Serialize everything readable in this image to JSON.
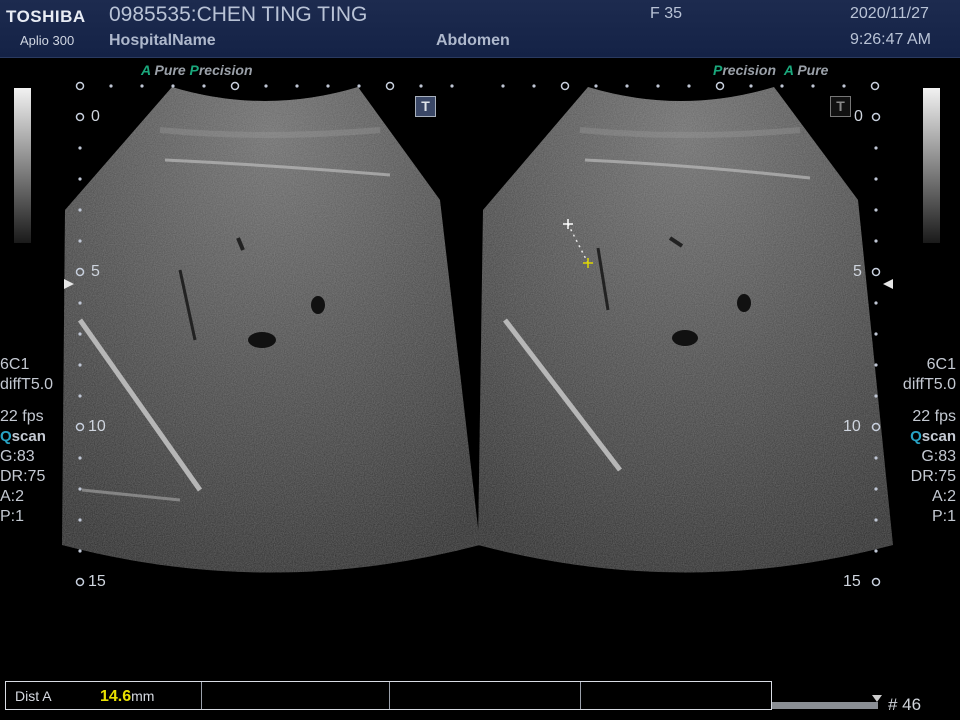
{
  "header": {
    "brand": "TOSHIBA",
    "model": "Aplio 300",
    "patient": "0985535:CHEN TING TING",
    "hospital": "HospitalName",
    "frame_rate_label": "F  35",
    "exam": "Abdomen",
    "date": "2020/11/27",
    "time": "9:26:47 AM"
  },
  "left_panel": {
    "tag_a": "A",
    "tag_pure": "Pure",
    "tag_p": "P",
    "tag_precision": "recision",
    "t_icon": "T",
    "depth_marks": [
      "0",
      "5",
      "10",
      "15"
    ]
  },
  "right_panel": {
    "tag_p": "P",
    "tag_precision": "recision",
    "tag_a": "A",
    "tag_pure": "Pure",
    "t_icon": "T",
    "depth_marks": [
      "0",
      "5",
      "10",
      "15"
    ]
  },
  "settings_left": {
    "probe": "6C1",
    "mode": "diffT5.0",
    "fps": "22 fps",
    "scan_q": "Q",
    "scan_rest": "scan",
    "gain": "G:83",
    "dr": "DR:75",
    "a": "A:2",
    "p": "P:1"
  },
  "settings_right": {
    "probe": "6C1",
    "mode": "diffT5.0",
    "fps": "22 fps",
    "scan_q": "Q",
    "scan_rest": "scan",
    "gain": "G:83",
    "dr": "DR:75",
    "a": "A:2",
    "p": "P:1"
  },
  "measurement": {
    "label": "Dist A",
    "value": "14.6",
    "unit": "mm"
  },
  "frame_number": "# 46",
  "colors": {
    "header_bg": "#1a2849",
    "accent_green": "#1aa87c",
    "measurement_value": "#e8e000",
    "qscan_q": "#28a3c4"
  }
}
